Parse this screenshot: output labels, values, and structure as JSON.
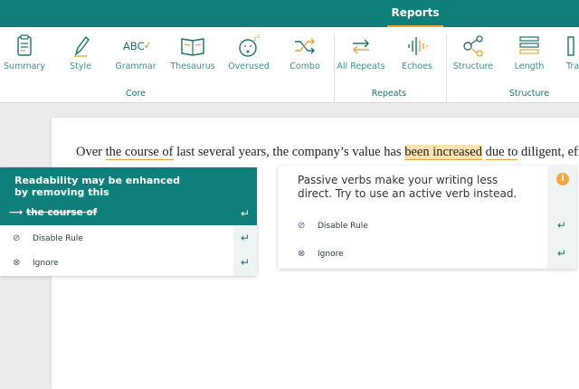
{
  "topbar": {
    "active_tab": "Reports"
  },
  "toolbar": {
    "tools": [
      {
        "label": "Summary",
        "icon": "clipboard-icon"
      },
      {
        "label": "Style",
        "icon": "pencil-icon"
      },
      {
        "label": "Grammar",
        "icon": "abc-check-icon"
      },
      {
        "label": "Thesaurus",
        "icon": "book-icon"
      },
      {
        "label": "Overused",
        "icon": "sleepy-face-icon"
      },
      {
        "label": "Combo",
        "icon": "shuffle-icon"
      },
      {
        "label": "All Repeats",
        "icon": "repeat-arrows-icon"
      },
      {
        "label": "Echoes",
        "icon": "soundwave-icon"
      },
      {
        "label": "Structure",
        "icon": "network-icon"
      },
      {
        "label": "Length",
        "icon": "ruler-bars-icon"
      },
      {
        "label": "Tra",
        "icon": "transitions-icon"
      }
    ],
    "groups": [
      "Core",
      "Repeats",
      "Structure"
    ]
  },
  "document": {
    "sentence": {
      "p1": "Over ",
      "p2": "the course of",
      "p3": " last several years, the company’s value has ",
      "p4": "been increased",
      "p5": " ",
      "p6": "due to",
      "p7": " diligent, efficien"
    }
  },
  "readability_card": {
    "message": "Readability may be enhanced by removing this",
    "suggestion": "the course of",
    "actions": [
      "Disable Rule",
      "Ignore"
    ]
  },
  "passive_card": {
    "message": "Passive verbs make your writing less direct. Try to use an active verb instead.",
    "info_glyph": "i",
    "actions": [
      "Disable Rule",
      "Ignore"
    ]
  },
  "colors": {
    "brand": "#0e7f7a",
    "accent": "#f0a742",
    "highlight": "#fbe3b0"
  }
}
